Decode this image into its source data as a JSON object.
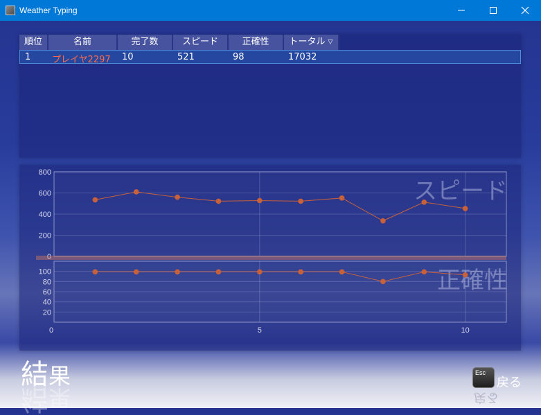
{
  "window": {
    "title": "Weather Typing"
  },
  "ranking": {
    "columns": [
      "順位",
      "名前",
      "完了数",
      "スピード",
      "正確性",
      "トータル"
    ],
    "sort_column": "トータル",
    "rows": [
      {
        "rank": "1",
        "name": "プレイヤ2297",
        "completed": "10",
        "speed": "521",
        "accuracy": "98",
        "total": "17032"
      }
    ]
  },
  "chart_data": [
    {
      "type": "line",
      "watermark": "スピード",
      "x": [
        1,
        2,
        3,
        4,
        5,
        6,
        7,
        8,
        9,
        10
      ],
      "series": [
        {
          "values": [
            535,
            610,
            560,
            522,
            528,
            522,
            552,
            336,
            513,
            453
          ]
        }
      ],
      "xlim": [
        0,
        11
      ],
      "ylim": [
        0,
        800
      ],
      "y_ticks": [
        0,
        200,
        400,
        600,
        800
      ],
      "color": "#c8603a",
      "grid": true
    },
    {
      "type": "line",
      "watermark": "正確性",
      "x": [
        1,
        2,
        3,
        4,
        5,
        6,
        7,
        8,
        9,
        10
      ],
      "series": [
        {
          "values": [
            99,
            99,
            99,
            99,
            99,
            99,
            99,
            80,
            99,
            93
          ]
        }
      ],
      "xlim": [
        0,
        11
      ],
      "ylim": [
        0,
        120
      ],
      "y_ticks": [
        20,
        40,
        60,
        80,
        100
      ],
      "x_ticks": [
        0,
        5,
        10
      ],
      "color": "#c8603a",
      "grid": true
    }
  ],
  "footer": {
    "result_big": "結",
    "result_small": "果",
    "esc_key_label": "Esc",
    "back_label": "戻る"
  },
  "colors": {
    "titlebar": "#0078d7",
    "line": "#c8603a",
    "name_text": "#ff6a4a"
  }
}
